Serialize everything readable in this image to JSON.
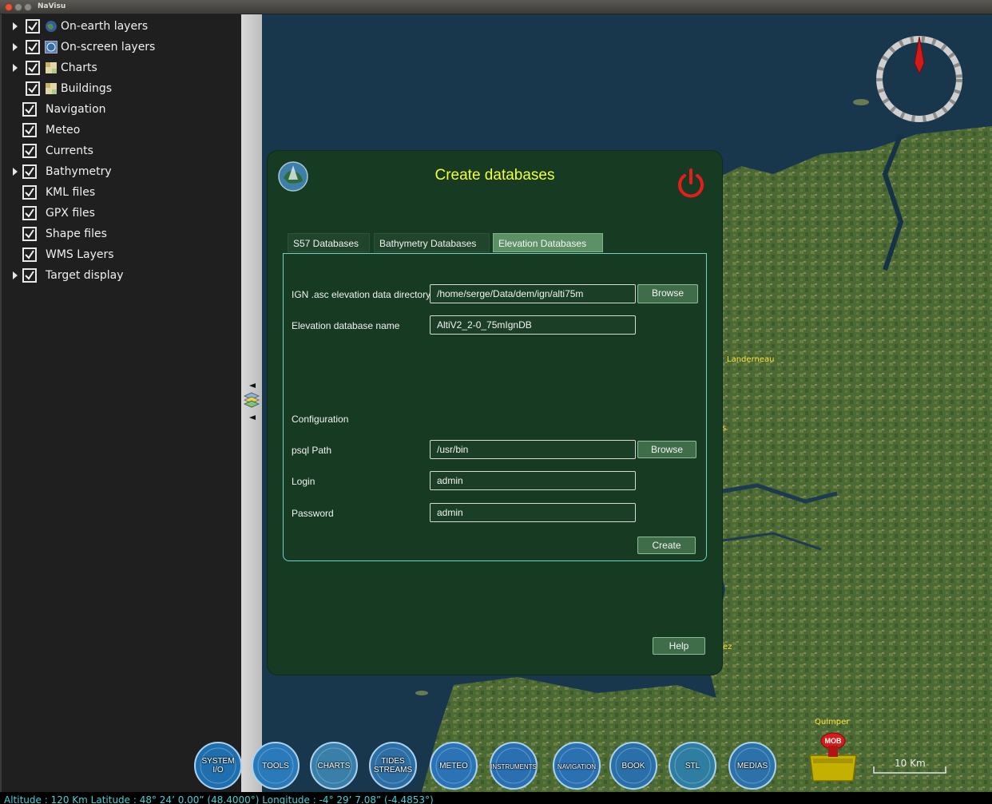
{
  "window": {
    "title": "NaVisu"
  },
  "layers": [
    {
      "label": "On-earth layers",
      "expandable": true,
      "checked": true,
      "icon": "globe-icon"
    },
    {
      "label": "On-screen layers",
      "expandable": true,
      "checked": true,
      "icon": "screen-globe-icon"
    },
    {
      "label": "Charts",
      "expandable": true,
      "checked": true,
      "icon": "chart-icon"
    },
    {
      "label": "Buildings",
      "expandable": false,
      "checked": true,
      "icon": "chart-icon"
    },
    {
      "label": "Navigation",
      "expandable": false,
      "checked": true
    },
    {
      "label": "Meteo",
      "expandable": false,
      "checked": true
    },
    {
      "label": "Currents",
      "expandable": false,
      "checked": true
    },
    {
      "label": "Bathymetry",
      "expandable": true,
      "checked": true
    },
    {
      "label": "KML files",
      "expandable": false,
      "checked": true
    },
    {
      "label": "GPX files",
      "expandable": false,
      "checked": true
    },
    {
      "label": "Shape files",
      "expandable": false,
      "checked": true
    },
    {
      "label": "WMS Layers",
      "expandable": false,
      "checked": true
    },
    {
      "label": "Target display",
      "expandable": true,
      "checked": true
    }
  ],
  "map": {
    "places": {
      "landerneau": "Landerneau",
      "quimper": "Quimper",
      "fragment_s": "s",
      "fragment_ez": "ez"
    },
    "scale_label": "10 Km"
  },
  "dialog": {
    "title": "Create databases",
    "tabs": [
      "S57 Databases",
      "Bathymetry Databases",
      "Elevation Databases"
    ],
    "active_tab": "Elevation Databases",
    "ign_dir_label": "IGN .asc elevation data directory",
    "ign_dir_value": "/home/serge/Data/dem/ign/alti75m",
    "db_name_label": "Elevation database name",
    "db_name_value": "AltiV2_2-0_75mIgnDB",
    "config_label": "Configuration",
    "psql_label": "psql Path",
    "psql_value": "/usr/bin",
    "login_label": "Login",
    "login_value": "admin",
    "password_label": "Password",
    "password_value": "admin",
    "browse_label": "Browse",
    "create_label": "Create",
    "help_label": "Help"
  },
  "toolbar": [
    {
      "label": "SYSTEM I/O",
      "line1": "SYSTEM",
      "line2": "I/O",
      "color": "#1f6fae"
    },
    {
      "label": "TOOLS",
      "line1": "TOOLS",
      "line2": "",
      "color": "#2a79b8"
    },
    {
      "label": "CHARTS",
      "line1": "CHARTS",
      "line2": "",
      "color": "#3a7fa8"
    },
    {
      "label": "TIDES STREAMS",
      "line1": "TIDES",
      "line2": "STREAMS",
      "color": "#2d6ea4"
    },
    {
      "label": "METEO",
      "line1": "METEO",
      "line2": "",
      "color": "#2b73b5"
    },
    {
      "label": "INSTRUMENTS",
      "line1": "INSTRUMENTS",
      "line2": "",
      "color": "#2a6fb0"
    },
    {
      "label": "NAVIGATION",
      "line1": "NAVIGATION",
      "line2": "",
      "color": "#2b70b0"
    },
    {
      "label": "BOOK",
      "line1": "BOOK",
      "line2": "",
      "color": "#2a6fa8"
    },
    {
      "label": "STL",
      "line1": "STL",
      "line2": "",
      "color": "#2f7da0"
    },
    {
      "label": "MEDIAS",
      "line1": "MEDIAS",
      "line2": "",
      "color": "#2c72a8"
    }
  ],
  "mob": {
    "label": "MOB"
  },
  "status": {
    "text": "Altitude : 120 Km Latitude :   48° 24’  0.00”  (48.4000°) Longitude :   -4° 29’  7.08”  (-4.4853°)"
  },
  "colors": {
    "accent_title": "#f2ff3a",
    "dialog_bg": "#163a22",
    "pane_border": "#6fd4c6",
    "power": "#e81c1c",
    "status_text": "#3fd2d6"
  }
}
